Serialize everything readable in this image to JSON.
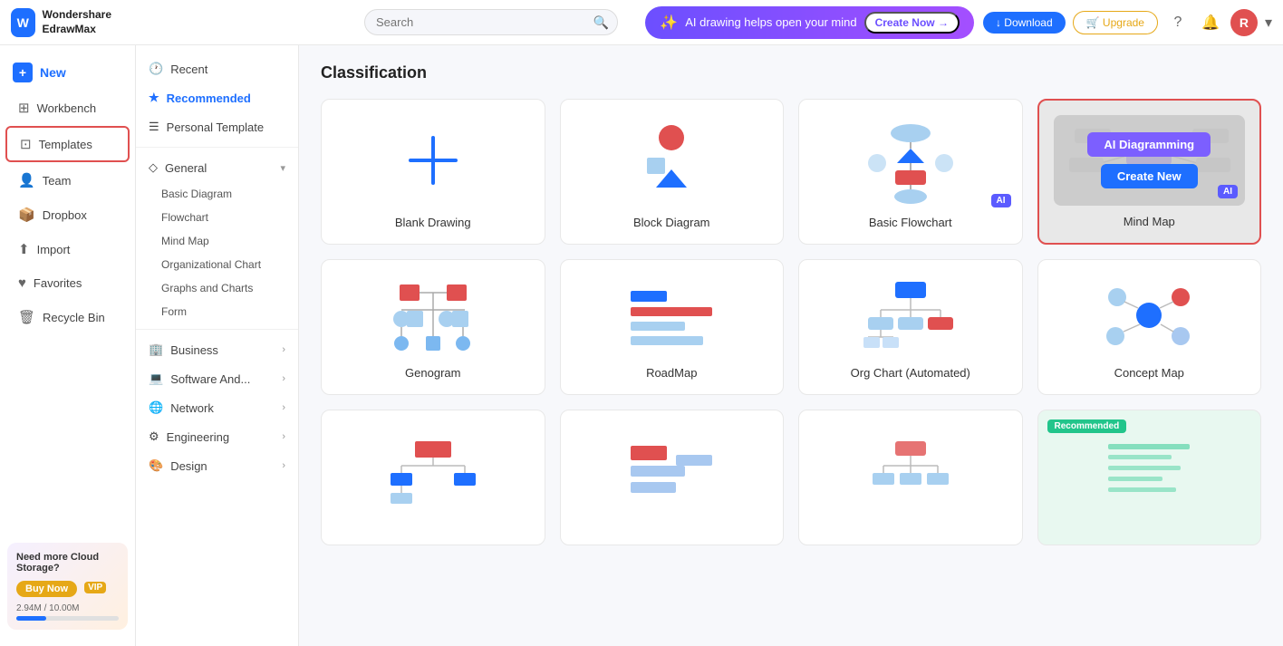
{
  "app": {
    "name": "Wondershare EdrawMax",
    "logo_letter": "W"
  },
  "topbar": {
    "search_placeholder": "Search",
    "ai_banner_text": "AI drawing helps open your mind",
    "ai_banner_create": "Create Now →",
    "download_label": "↓ Download",
    "upgrade_label": "🛒 Upgrade"
  },
  "sidebar": {
    "items": [
      {
        "id": "new",
        "label": "New",
        "icon": "+"
      },
      {
        "id": "workbench",
        "label": "Workbench",
        "icon": "⊞"
      },
      {
        "id": "templates",
        "label": "Templates",
        "icon": "⊡"
      },
      {
        "id": "team",
        "label": "Team",
        "icon": "👤"
      },
      {
        "id": "dropbox",
        "label": "Dropbox",
        "icon": "📦"
      },
      {
        "id": "import",
        "label": "Import",
        "icon": "⬆"
      },
      {
        "id": "favorites",
        "label": "Favorites",
        "icon": "♥"
      },
      {
        "id": "recycle_bin",
        "label": "Recycle Bin",
        "icon": "🗑"
      }
    ],
    "cloud_storage": {
      "title": "Need more Cloud Storage?",
      "buy_now": "Buy Now",
      "vip": "VIP",
      "used": "2.94M",
      "total": "10.00M"
    }
  },
  "middle_nav": {
    "items": [
      {
        "id": "recent",
        "label": "Recent",
        "icon": "🕐"
      },
      {
        "id": "recommended",
        "label": "Recommended",
        "icon": "★",
        "active": true
      },
      {
        "id": "personal_template",
        "label": "Personal Template",
        "icon": "☰"
      },
      {
        "id": "general",
        "label": "General",
        "icon": "◇",
        "expandable": true
      },
      {
        "id": "basic_diagram",
        "label": "Basic Diagram",
        "sub": true
      },
      {
        "id": "flowchart",
        "label": "Flowchart",
        "sub": true
      },
      {
        "id": "mind_map",
        "label": "Mind Map",
        "sub": true
      },
      {
        "id": "organizational_chart",
        "label": "Organizational Chart",
        "sub": true
      },
      {
        "id": "graphs_and_charts",
        "label": "Graphs and Charts",
        "sub": true
      },
      {
        "id": "form",
        "label": "Form",
        "sub": true
      },
      {
        "id": "business",
        "label": "Business",
        "icon": "⊡",
        "expandable": true
      },
      {
        "id": "software_and",
        "label": "Software And...",
        "icon": "⊡",
        "expandable": true
      },
      {
        "id": "network",
        "label": "Network",
        "icon": "⊡",
        "expandable": true
      },
      {
        "id": "engineering",
        "label": "Engineering",
        "icon": "⊡",
        "expandable": true
      },
      {
        "id": "design",
        "label": "Design",
        "icon": "⊡",
        "expandable": true
      }
    ]
  },
  "content": {
    "section_title": "Classification",
    "cards": [
      {
        "id": "blank_drawing",
        "label": "Blank Drawing",
        "type": "blank"
      },
      {
        "id": "block_diagram",
        "label": "Block Diagram",
        "type": "block",
        "ai": false
      },
      {
        "id": "basic_flowchart",
        "label": "Basic Flowchart",
        "type": "flowchart",
        "ai": true
      },
      {
        "id": "mind_map",
        "label": "Mind Map",
        "type": "mindmap",
        "highlighted": true,
        "overlay": true,
        "ai": true
      },
      {
        "id": "genogram",
        "label": "Genogram",
        "type": "genogram"
      },
      {
        "id": "roadmap",
        "label": "RoadMap",
        "type": "roadmap"
      },
      {
        "id": "org_chart",
        "label": "Org Chart (Automated)",
        "type": "orgchart"
      },
      {
        "id": "concept_map",
        "label": "Concept Map",
        "type": "conceptmap"
      },
      {
        "id": "diagram1",
        "label": "",
        "type": "diagram1"
      },
      {
        "id": "diagram2",
        "label": "",
        "type": "diagram2"
      },
      {
        "id": "diagram3",
        "label": "",
        "type": "diagram3"
      },
      {
        "id": "diagram4",
        "label": "",
        "type": "diagram4_recommended",
        "recommended": true
      }
    ],
    "ai_diagramming_label": "AI Diagramming",
    "create_new_label": "Create New"
  }
}
